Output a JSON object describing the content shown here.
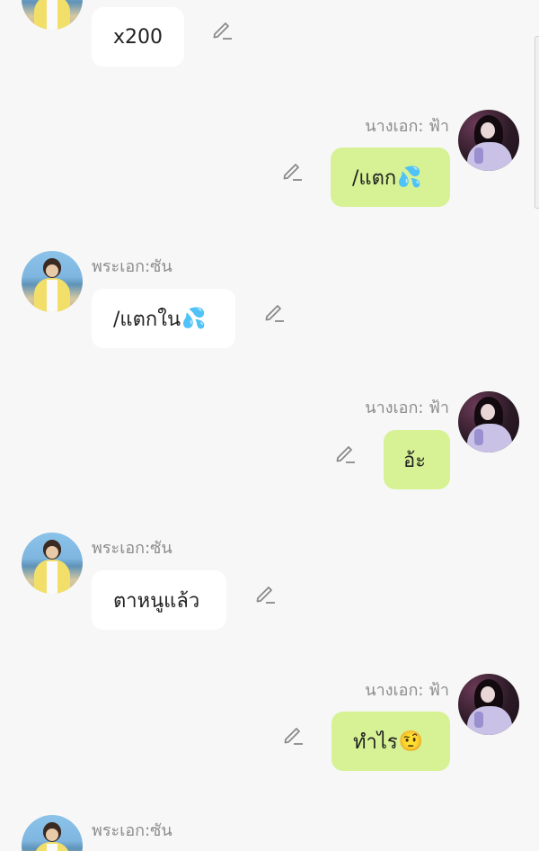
{
  "messages": [
    {
      "side": "left",
      "sender": "",
      "text": "x200",
      "emoji": ""
    },
    {
      "side": "right",
      "sender": "นางเอก: ฟ้า",
      "text": "/แตก",
      "emoji": "💦"
    },
    {
      "side": "left",
      "sender": "พระเอก:ซัน",
      "text": "/แตกใน",
      "emoji": "💦"
    },
    {
      "side": "right",
      "sender": "นางเอก: ฟ้า",
      "text": "อ้ะ",
      "emoji": ""
    },
    {
      "side": "left",
      "sender": "พระเอก:ซัน",
      "text": "ตาหนูแล้ว",
      "emoji": ""
    },
    {
      "side": "right",
      "sender": "นางเอก: ฟ้า",
      "text": "ทำไร",
      "emoji": "🤨"
    },
    {
      "side": "left",
      "sender": "พระเอก:ซัน",
      "text": "",
      "emoji": ""
    }
  ],
  "icons": {
    "edit": "pencil-icon",
    "avatar_male": "avatar-photo-boy",
    "avatar_female": "avatar-photo-girl"
  },
  "colors": {
    "background": "#f7f7f7",
    "bubble_left": "#ffffff",
    "bubble_right": "#d7f295",
    "sender_name": "#8c8c8c",
    "message_text": "#222222",
    "icon": "#8a8a8a"
  }
}
